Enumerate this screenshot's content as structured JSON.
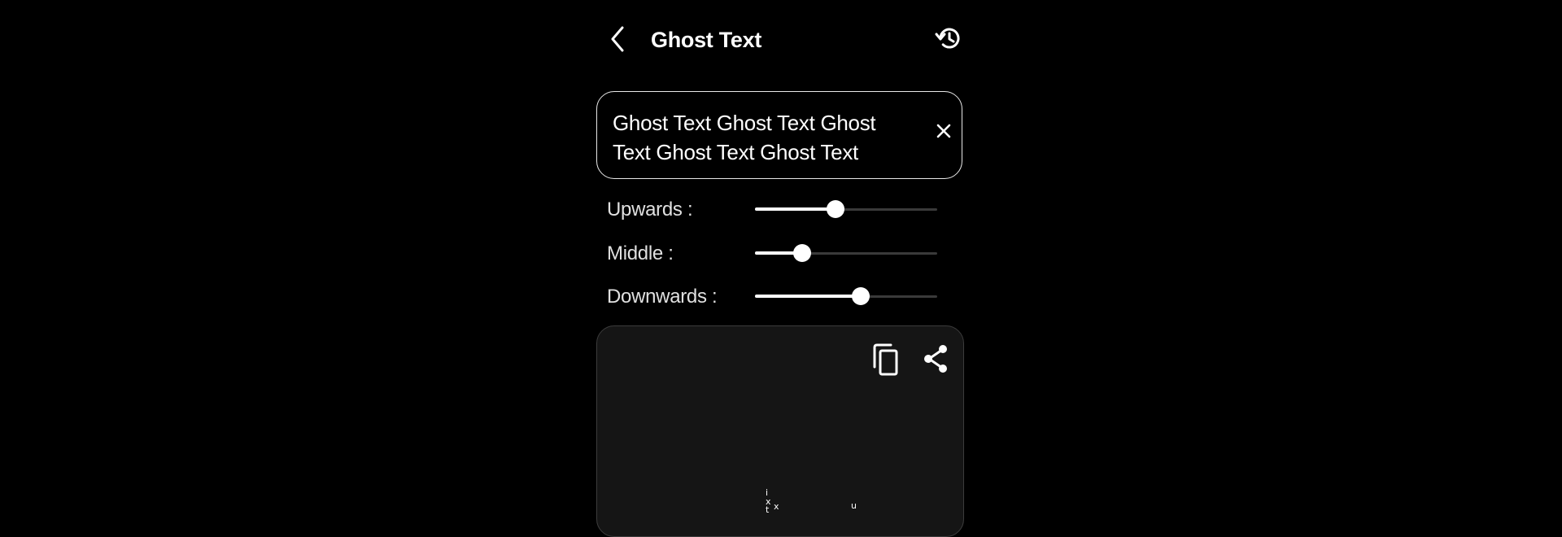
{
  "header": {
    "title": "Ghost Text",
    "back_icon": "chevron-left-icon",
    "history_icon": "history-icon"
  },
  "input": {
    "value": "Ghost Text Ghost Text Ghost Text Ghost Text Ghost Text",
    "clear_icon": "close-icon"
  },
  "sliders": [
    {
      "label": "Upwards :",
      "level": 0.44
    },
    {
      "label": "Middle :",
      "level": 0.26
    },
    {
      "label": "Downwards :",
      "level": 0.58
    }
  ],
  "output": {
    "copy_icon": "copy-icon",
    "share_icon": "share-icon",
    "glyphs": [
      "i",
      "x",
      "x",
      "t",
      "u"
    ]
  },
  "colors": {
    "background": "#000000",
    "foreground": "#ffffff",
    "output_panel": "#151515",
    "track": "#3a3a3a"
  }
}
